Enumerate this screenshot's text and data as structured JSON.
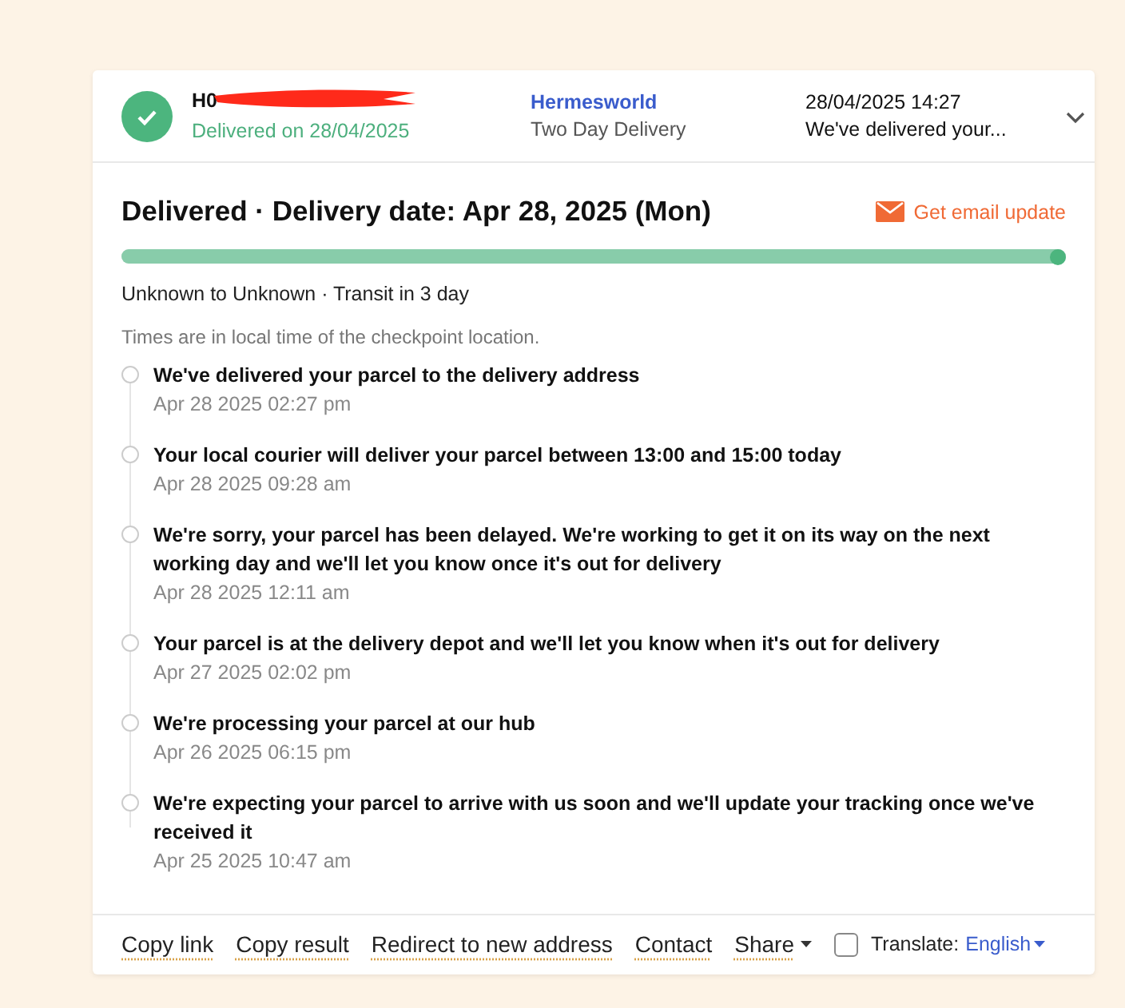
{
  "shipment": {
    "tracking_number": "H0",
    "status": "Delivered on 28/04/2025",
    "carrier": "Hermesworld",
    "service": "Two Day Delivery",
    "latest_time": "28/04/2025 14:27",
    "latest_event": "We've delivered your...",
    "expanded": true
  },
  "detail": {
    "title": "Delivered · Delivery date: Apr 28, 2025 (Mon)",
    "email_update": "Get email update",
    "progress": {
      "level": 1
    },
    "route": "Unknown to Unknown · Transit in 3 day",
    "note": "Times are in local time of the checkpoint location."
  },
  "checkpoints": [
    {
      "message": "We've delivered your parcel to the delivery address",
      "time": "Apr 28 2025 02:27 pm"
    },
    {
      "message": "Your local courier will deliver your parcel between 13:00 and 15:00 today",
      "time": "Apr 28 2025 09:28 am"
    },
    {
      "message": "We're sorry, your parcel has been delayed. We're working to get it on its way on the next working day and we'll let you know once it's out for delivery",
      "time": "Apr 28 2025 12:11 am"
    },
    {
      "message": "Your parcel is at the delivery depot and we'll let you know when it's out for delivery",
      "time": "Apr 27 2025 02:02 pm"
    },
    {
      "message": "We're processing your parcel at our hub",
      "time": "Apr 26 2025 06:15 pm"
    },
    {
      "message": "We're expecting your parcel to arrive with us soon and we'll update your tracking once we've received it",
      "time": "Apr 25 2025 10:47 am"
    }
  ],
  "footer": {
    "links": [
      {
        "label": "Copy link",
        "kind": "link"
      },
      {
        "label": "Copy result",
        "kind": "link"
      },
      {
        "label": "Redirect to new address",
        "kind": "link"
      },
      {
        "label": "Contact",
        "kind": "link"
      },
      {
        "label": "Share",
        "kind": "dropdown"
      }
    ],
    "translate": {
      "checked": false,
      "label": "Translate:",
      "language": "English"
    }
  }
}
